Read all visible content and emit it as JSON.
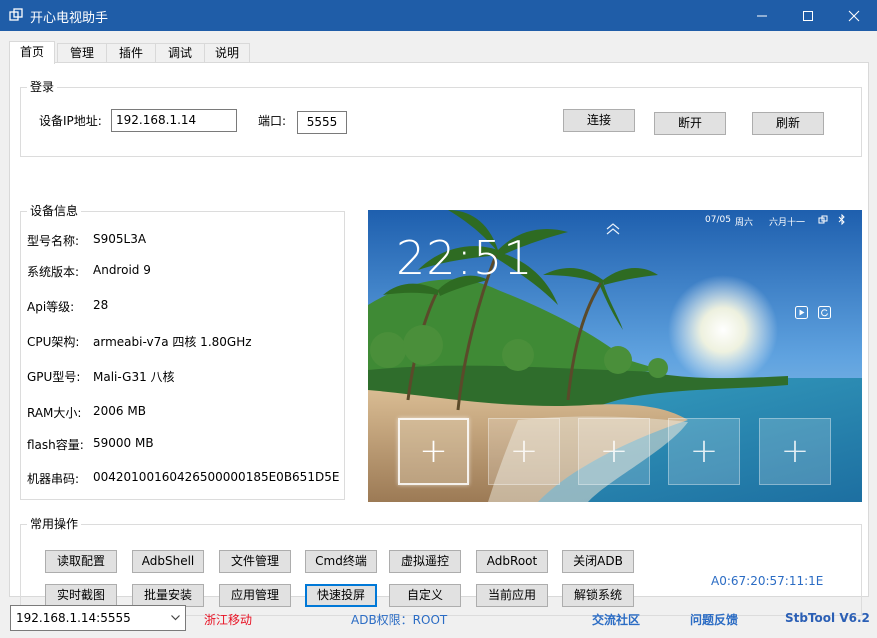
{
  "window": {
    "title": "开心电视助手",
    "minimize_glyph": "—",
    "maximize_glyph": "☐",
    "close_glyph": "✕"
  },
  "tabs": [
    {
      "label": "首页"
    },
    {
      "label": "管理"
    },
    {
      "label": "插件"
    },
    {
      "label": "调试"
    },
    {
      "label": "说明"
    }
  ],
  "login": {
    "group_title": "登录",
    "ip_label": "设备IP地址:",
    "ip_value": "192.168.1.14",
    "port_label": "端口:",
    "port_value": "5555",
    "connect_label": "连接",
    "disconnect_label": "断开",
    "refresh_label": "刷新"
  },
  "device_info": {
    "group_title": "设备信息",
    "rows": [
      {
        "key": "型号名称:",
        "value": "S905L3A"
      },
      {
        "key": "系统版本:",
        "value": "Android 9"
      },
      {
        "key": "Api等级:",
        "value": "28"
      },
      {
        "key": "CPU架构:",
        "value": "armeabi-v7a 四核 1.80GHz"
      },
      {
        "key": "GPU型号:",
        "value": "Mali-G31 八核"
      },
      {
        "key": "RAM大小:",
        "value": "2006 MB"
      },
      {
        "key": "flash容量:",
        "value": "59000 MB"
      },
      {
        "key": "机器串码:",
        "value": "00420100160426500000185E0B651D5E"
      }
    ]
  },
  "tv_screen": {
    "clock": "22:51",
    "date": "07/05",
    "weekday": "周六",
    "lunar": "六月十一",
    "tile_glyph": "+"
  },
  "common_ops": {
    "group_title": "常用操作",
    "row1": [
      "读取配置",
      "AdbShell",
      "文件管理",
      "Cmd终端",
      "虚拟遥控",
      "AdbRoot",
      "关闭ADB"
    ],
    "row2": [
      "实时截图",
      "批量安装",
      "应用管理",
      "快速投屏",
      "自定义",
      "当前应用",
      "解锁系统"
    ],
    "mac": "A0:67:20:57:11:1E"
  },
  "status": {
    "device_select": "192.168.1.14:5555",
    "carrier": "浙江移动",
    "adb_perm": "ADB权限：ROOT",
    "community": "交流社区",
    "feedback": "问题反馈",
    "version": "StbTool V6.2"
  },
  "colors": {
    "titlebar": "#1f5da8",
    "carrier": "#e81123",
    "link": "#2b6cc4",
    "version": "#2b5fb5"
  }
}
